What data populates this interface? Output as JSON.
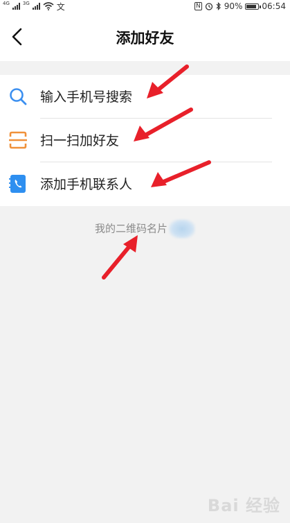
{
  "status_bar": {
    "network_1": "4G",
    "network_2": "3G",
    "carrier_glyph": "文",
    "nfc": "N",
    "battery": "90%",
    "battery_level": 0.9,
    "time": "06:54"
  },
  "header": {
    "title": "添加好友",
    "back_icon": "chevron-left-icon"
  },
  "menu": [
    {
      "label": "输入手机号搜索",
      "icon": "search-icon",
      "color": "#3b8ff0"
    },
    {
      "label": "扫一扫加好友",
      "icon": "scan-icon",
      "color": "#f0913a"
    },
    {
      "label": "添加手机联系人",
      "icon": "phone-contacts-icon",
      "color": "#2e8ff0"
    }
  ],
  "qr_card": {
    "label": "我的二维码名片"
  },
  "annotation": {
    "arrow_color": "#e8202a"
  },
  "watermark": {
    "text": "Bai 经验"
  }
}
